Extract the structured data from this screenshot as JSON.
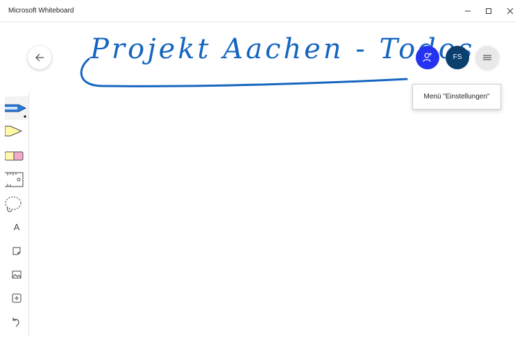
{
  "window": {
    "title": "Microsoft Whiteboard",
    "controls": [
      "minimize",
      "maximize",
      "close"
    ]
  },
  "board": {
    "ink_title": "Projekt Aachen - Todos",
    "ink_color": "#1565c0"
  },
  "header": {
    "back_icon": "arrow-left-icon",
    "invite_icon": "invite-person-icon",
    "invite_color": "#2532f2",
    "avatar_initials": "FS",
    "avatar_color": "#0b3f6e",
    "menu_icon": "hamburger-icon"
  },
  "tooltip": {
    "text": "Menü \"Einstellungen\""
  },
  "toolbar": {
    "tools": [
      {
        "name": "pen",
        "icon": "pen-icon",
        "selected": true
      },
      {
        "name": "highlighter",
        "icon": "highlighter-icon"
      },
      {
        "name": "eraser",
        "icon": "eraser-icon"
      },
      {
        "name": "ruler",
        "icon": "ruler-icon"
      },
      {
        "name": "lasso",
        "icon": "lasso-icon"
      },
      {
        "name": "text",
        "icon": "text-icon",
        "label": "A"
      },
      {
        "name": "note",
        "icon": "note-icon"
      },
      {
        "name": "image",
        "icon": "image-icon"
      },
      {
        "name": "add",
        "icon": "add-icon"
      },
      {
        "name": "undo",
        "icon": "undo-icon"
      }
    ]
  }
}
